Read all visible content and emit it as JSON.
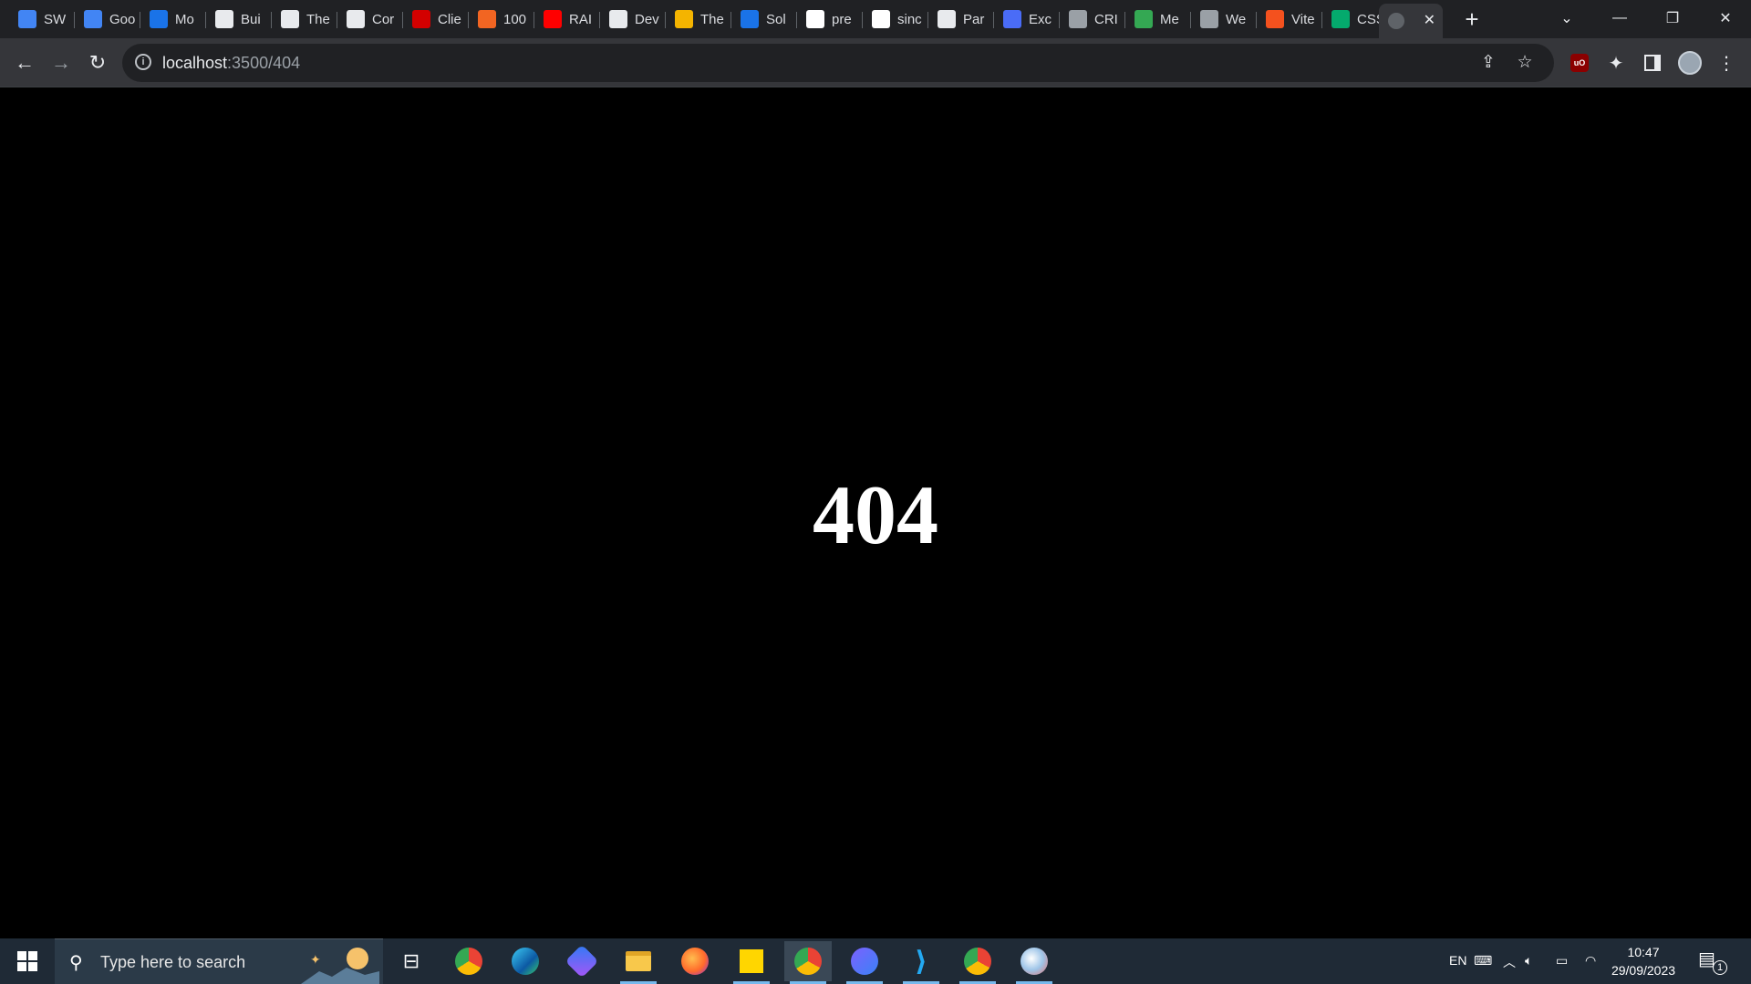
{
  "browser": {
    "tabs": [
      {
        "label": "SW",
        "icon": "docs-icon",
        "color": "#4285f4"
      },
      {
        "label": "Goo",
        "icon": "calendar-icon",
        "color": "#4285f4"
      },
      {
        "label": "Mo",
        "icon": "contacts-icon",
        "color": "#1a73e8"
      },
      {
        "label": "Bui",
        "icon": "site-icon",
        "color": "#e8eaed"
      },
      {
        "label": "The",
        "icon": "site-icon",
        "color": "#e8eaed"
      },
      {
        "label": "Cor",
        "icon": "m-icon",
        "color": "#e8eaed"
      },
      {
        "label": "Clie",
        "icon": "w-icon",
        "color": "#d30000"
      },
      {
        "label": "100",
        "icon": "dots-icon",
        "color": "#f26522"
      },
      {
        "label": "RAI",
        "icon": "youtube-icon",
        "color": "#ff0000"
      },
      {
        "label": "Dev",
        "icon": "search-page-icon",
        "color": "#e8eaed"
      },
      {
        "label": "The",
        "icon": "pen-icon",
        "color": "#f4b400"
      },
      {
        "label": "Sol",
        "icon": "infinity-icon",
        "color": "#1a73e8"
      },
      {
        "label": "pre",
        "icon": "github-icon",
        "color": "#ffffff"
      },
      {
        "label": "sinc",
        "icon": "github-icon",
        "color": "#ffffff"
      },
      {
        "label": "Par",
        "icon": "site-icon",
        "color": "#e8eaed"
      },
      {
        "label": "Exc",
        "icon": "tool-icon",
        "color": "#4a6cf7"
      },
      {
        "label": "CRI",
        "icon": "globe-icon",
        "color": "#9aa0a6"
      },
      {
        "label": "Me",
        "icon": "colorful-icon",
        "color": "#34a853"
      },
      {
        "label": "We",
        "icon": "globe-icon",
        "color": "#9aa0a6"
      },
      {
        "label": "Vite",
        "icon": "vite-icon",
        "color": "#f4511e"
      },
      {
        "label": "CSS",
        "icon": "w3-icon",
        "color": "#04aa6d"
      }
    ],
    "active_tab": {
      "label": "",
      "icon": "globe-icon"
    },
    "url_host": "localhost",
    "url_path": ":3500/404"
  },
  "page": {
    "heading": "404"
  },
  "taskbar": {
    "search_placeholder": "Type here to search",
    "language": "EN",
    "time": "10:47",
    "date": "29/09/2023",
    "notification_count": "1"
  }
}
